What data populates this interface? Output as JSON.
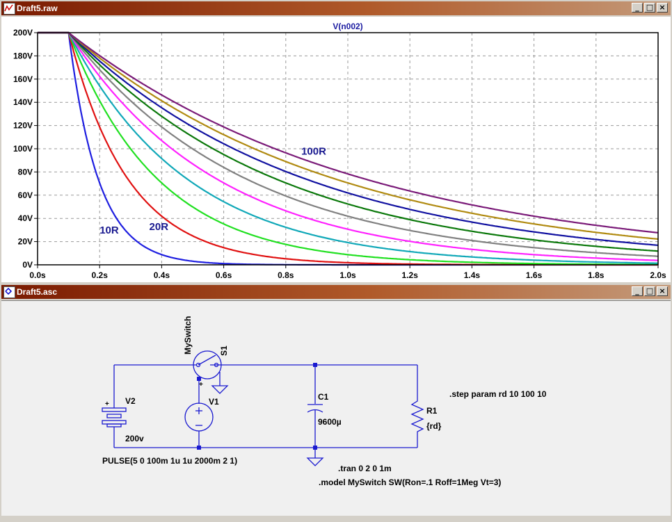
{
  "plot_window": {
    "title": "Draft5.raw"
  },
  "schematic_window": {
    "title": "Draft5.asc"
  },
  "window_buttons": [
    "_",
    "□",
    "×"
  ],
  "chart_data": {
    "type": "line",
    "title": "V(n002)",
    "xlim": [
      0,
      2.0
    ],
    "ylim": [
      0,
      200
    ],
    "grid": true,
    "x_ticks": [
      "0.0s",
      "0.2s",
      "0.4s",
      "0.6s",
      "0.8s",
      "1.0s",
      "1.2s",
      "1.4s",
      "1.6s",
      "1.8s",
      "2.0s"
    ],
    "y_ticks": [
      "0V",
      "20V",
      "40V",
      "60V",
      "80V",
      "100V",
      "120V",
      "140V",
      "160V",
      "180V",
      "200V"
    ],
    "pulse_off_time": 0.1,
    "initial_voltage": 200,
    "capacitance_uF": 9600,
    "series": [
      {
        "param_rd": 10,
        "color": "#1e1ee0"
      },
      {
        "param_rd": 20,
        "color": "#e01010"
      },
      {
        "param_rd": 30,
        "color": "#20e020"
      },
      {
        "param_rd": 40,
        "color": "#10a8b8"
      },
      {
        "param_rd": 50,
        "color": "#ff20ff"
      },
      {
        "param_rd": 60,
        "color": "#808080"
      },
      {
        "param_rd": 70,
        "color": "#0a780a"
      },
      {
        "param_rd": 80,
        "color": "#1010a0"
      },
      {
        "param_rd": 90,
        "color": "#b08a10"
      },
      {
        "param_rd": 100,
        "color": "#7a1a78"
      }
    ],
    "annotations": [
      {
        "text": "100R",
        "x": 0.85,
        "y": 95
      },
      {
        "text": "20R",
        "x": 0.36,
        "y": 30
      },
      {
        "text": "10R",
        "x": 0.2,
        "y": 27
      }
    ]
  },
  "schematic": {
    "switch_name": "S1",
    "switch_model": "MySwitch",
    "v1_name": "V1",
    "v2_name": "V2",
    "v2_value": "200v",
    "c1_name": "C1",
    "c1_value": "9600µ",
    "r1_name": "R1",
    "r1_value": "{rd}",
    "pulse_text": "PULSE(5 0 100m 1u 1u 2000m 2 1)",
    "plus_sign": "+",
    "step_directive": ".step param rd 10 100 10",
    "tran_directive": ".tran 0 2 0 1m",
    "model_directive": ".model MySwitch  SW(Ron=.1 Roff=1Meg Vt=3)"
  }
}
